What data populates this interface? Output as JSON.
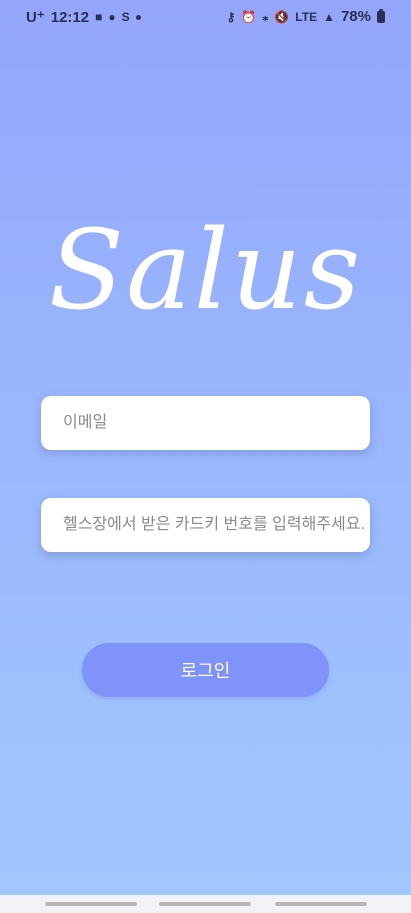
{
  "status_bar": {
    "carrier": "U⁺",
    "time": "12:12",
    "battery_percent": "78%",
    "network": "LTE",
    "icons_left": [
      "puzzle-icon",
      "talk-bubble-icon",
      "s-app-icon",
      "dot-indicator"
    ],
    "icons_right": [
      "key-icon",
      "alarm-icon",
      "bluetooth-icon",
      "mute-icon",
      "lte-icon",
      "signal-icon",
      "battery-icon"
    ]
  },
  "app": {
    "logo_text": "Salus"
  },
  "form": {
    "email_placeholder": "이메일",
    "card_placeholder": "헬스장에서 받은 카드키 번호를 입력해주세요.",
    "login_label": "로그인"
  },
  "colors": {
    "gradient_top": "#93a6fb",
    "gradient_bottom": "#a2c8fd",
    "button": "#7f93fb",
    "field_bg": "#ffffff"
  }
}
